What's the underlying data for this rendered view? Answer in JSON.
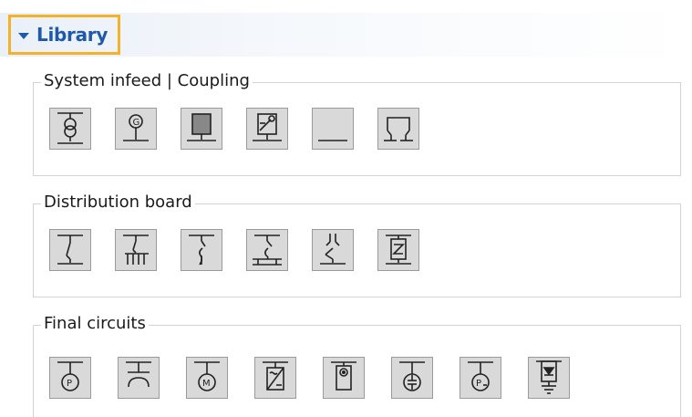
{
  "library": {
    "title": "Library",
    "highlight_color": "#f4b12a",
    "title_color": "#1f5aa8"
  },
  "groups": [
    {
      "label": "System infeed | Coupling",
      "items": [
        {
          "icon": "transformer-icon"
        },
        {
          "icon": "generator-icon"
        },
        {
          "icon": "grid-infeed-icon"
        },
        {
          "icon": "solar-infeed-icon"
        },
        {
          "icon": "busbar-icon"
        },
        {
          "icon": "coupling-icon"
        }
      ]
    },
    {
      "label": "Distribution board",
      "items": [
        {
          "icon": "switch-disconnector-icon"
        },
        {
          "icon": "busbar-distributor-icon"
        },
        {
          "icon": "fuse-switch-icon"
        },
        {
          "icon": "fuse-busbar-icon"
        },
        {
          "icon": "surge-arrester-icon"
        },
        {
          "icon": "distribution-transformer-icon"
        }
      ]
    },
    {
      "label": "Final circuits",
      "items": [
        {
          "icon": "power-consumer-icon"
        },
        {
          "icon": "multi-consumer-icon"
        },
        {
          "icon": "motor-icon"
        },
        {
          "icon": "converter-icon"
        },
        {
          "icon": "charging-station-icon"
        },
        {
          "icon": "capacitor-icon"
        },
        {
          "icon": "power-factor-icon"
        },
        {
          "icon": "ground-consumer-icon"
        }
      ]
    }
  ]
}
